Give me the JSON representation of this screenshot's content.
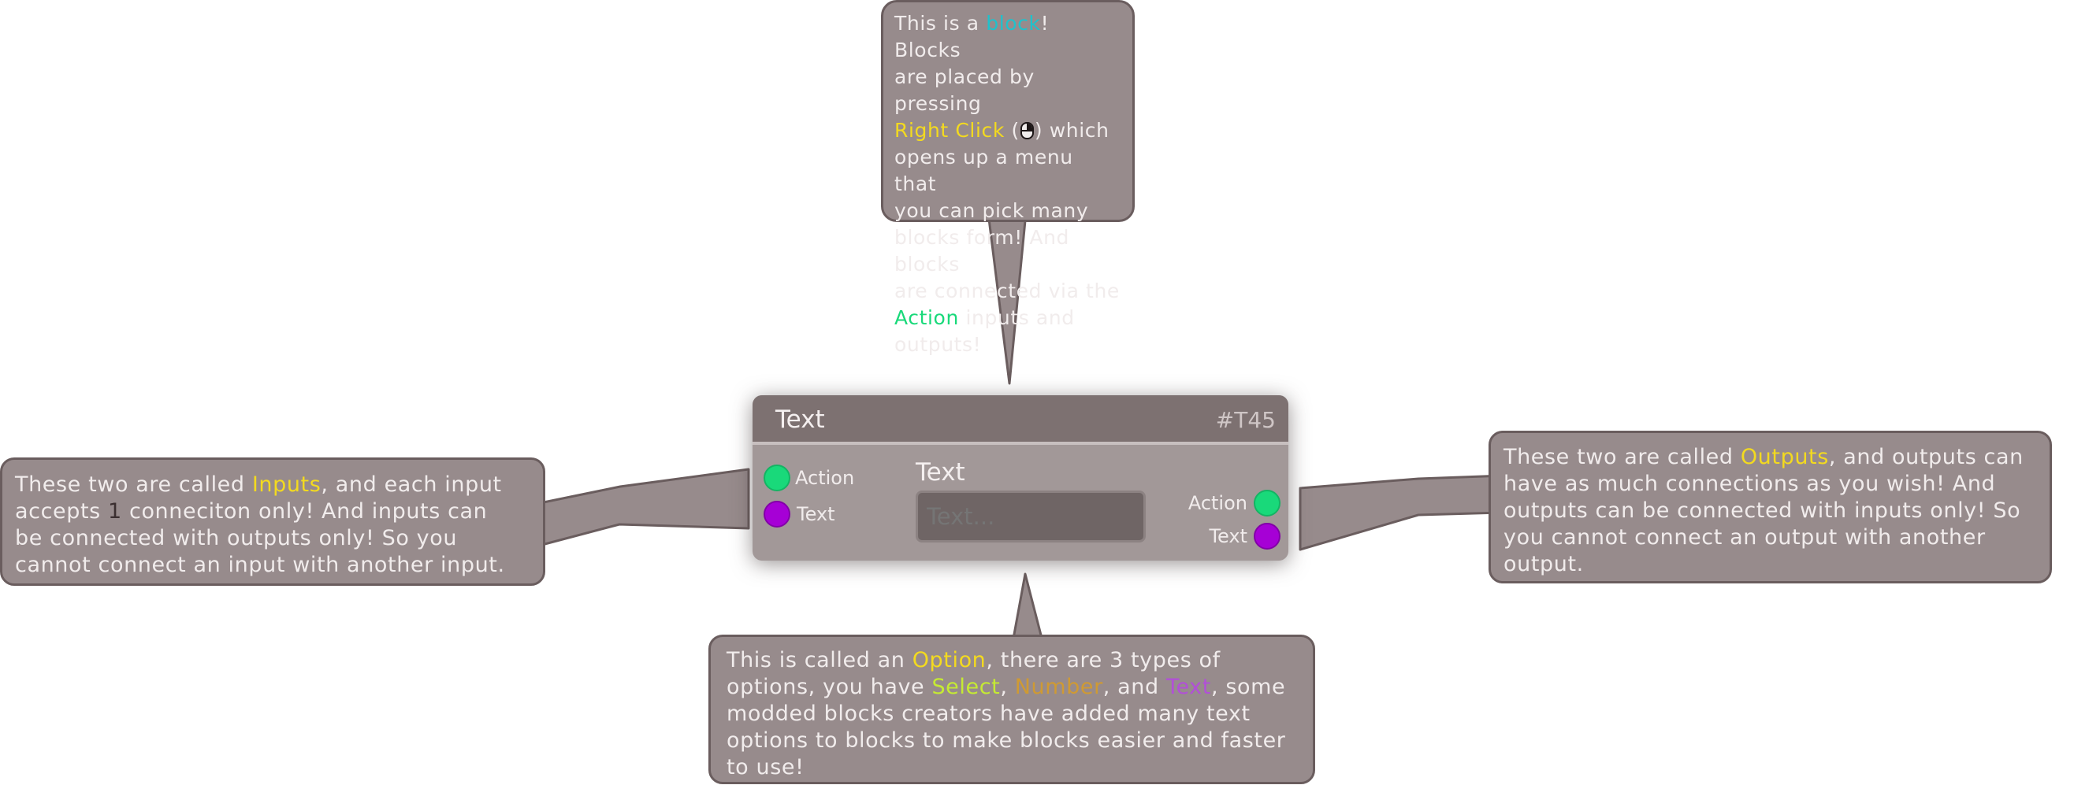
{
  "block": {
    "title": "Text",
    "id": "#T45",
    "inputs": [
      {
        "label": "Action",
        "color": "#19d97a"
      },
      {
        "label": "Text",
        "color": "#a600d6"
      }
    ],
    "outputs": [
      {
        "label": "Action",
        "color": "#19d97a"
      },
      {
        "label": "Text",
        "color": "#a600d6"
      }
    ],
    "option": {
      "label": "Text",
      "placeholder": "Text..."
    }
  },
  "callouts": {
    "top": {
      "l1a": "This is a ",
      "l1b": "block",
      "l1c": "! Blocks",
      "l2": "are placed by pressing",
      "l3a": "Right Click",
      "l3b": " (",
      "l3c": ") which",
      "l4": "opens up a menu that",
      "l5": "you can pick many",
      "l6": "blocks form! And blocks",
      "l7": "are connected via the",
      "l8a": "Action",
      "l8b": " inputs and",
      "l9": "outputs!"
    },
    "left": {
      "l1a": "These two are called ",
      "l1b": "Inputs",
      "l1c": ", and each input",
      "l2a": "accepts ",
      "l2b": "1",
      "l2c": " conneciton only! And inputs can",
      "l3": "be connected with outputs only! So you",
      "l4": "cannot connect an input with another input."
    },
    "right": {
      "l1a": "These two are called ",
      "l1b": "Outputs",
      "l1c": ", and outputs can",
      "l2": "have as much connections as you wish! And",
      "l3": "outputs can be connected with inputs only! So",
      "l4": "you cannot connect an output with another",
      "l5": "output."
    },
    "bottom": {
      "l1a": "This is called an ",
      "l1b": "Option",
      "l1c": ", there are 3 types of",
      "l2a": "options, you have ",
      "l2b": "Select",
      "l2c": ", ",
      "l2d": "Number",
      "l2e": ", and ",
      "l2f": "Text",
      "l2g": ", some",
      "l3": "modded blocks creators have added many text",
      "l4": "options to blocks to make blocks easier and faster",
      "l5": "to use!"
    }
  },
  "colors": {
    "bubble": "#978b8c",
    "bubble_border": "#6a5d5e",
    "highlight_yellow": "#f3da1f",
    "highlight_cyan": "#1fc2cc",
    "highlight_green": "#19d97a",
    "highlight_lime": "#c5ea33",
    "highlight_orange": "#cf9a33",
    "highlight_purple": "#b24fd8"
  }
}
